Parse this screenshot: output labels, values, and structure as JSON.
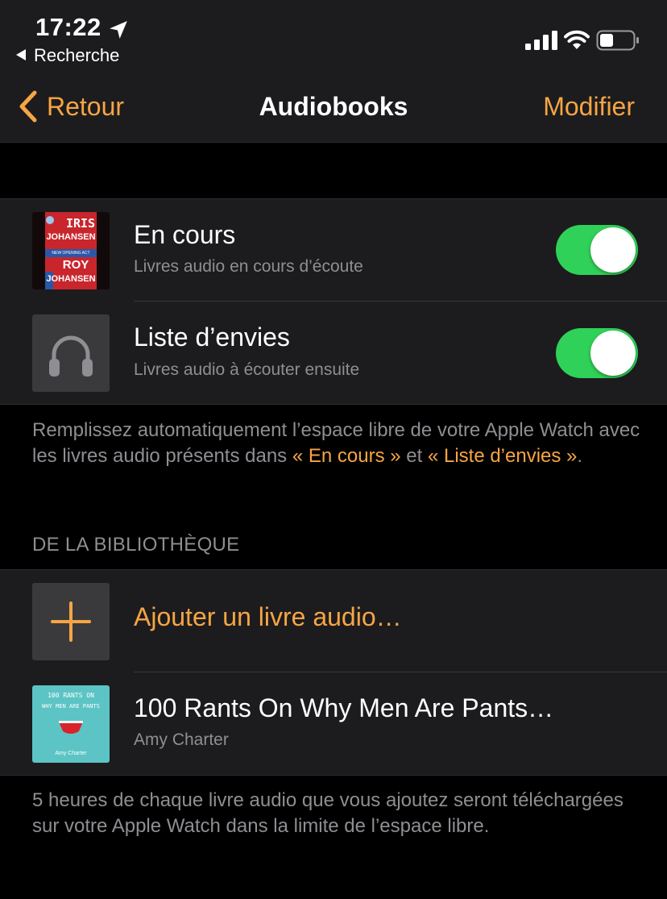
{
  "status_bar": {
    "time": "17:22",
    "back_app": "Recherche",
    "icons": [
      "location-arrow-icon",
      "signal-icon",
      "wifi-icon",
      "battery-icon"
    ]
  },
  "nav": {
    "back_label": "Retour",
    "title": "Audiobooks",
    "edit_label": "Modifier"
  },
  "auto_sync": {
    "items": [
      {
        "title": "En cours",
        "subtitle": "Livres audio en cours d’écoute",
        "enabled": true,
        "cover": {
          "line1": "IRIS",
          "line2": "JOHANSEN",
          "line3": "ROY",
          "line4": "JOHANSEN",
          "band": "NEW OPENING ACT"
        }
      },
      {
        "title": "Liste d’envies",
        "subtitle": "Livres audio à écouter ensuite",
        "enabled": true,
        "icon": "headphones-icon"
      }
    ],
    "footer_part1": "Remplissez automatiquement l’espace libre de votre Apple Watch avec les livres audio présents dans ",
    "footer_link1": "« En cours »",
    "footer_part2": " et ",
    "footer_link2": "« Liste d’envies »",
    "footer_part3": "."
  },
  "library": {
    "header": "DE LA BIBLIOTHÈQUE",
    "add_label": "Ajouter un livre audio…",
    "books": [
      {
        "title": "100 Rants On Why Men Are Pants…",
        "author": "Amy Charter",
        "cover": {
          "line1": "100 RANTS ON",
          "line2": "WHY MEN ARE PANTS",
          "author": "Amy Charter"
        }
      }
    ],
    "footer": "5 heures de chaque livre audio que vous ajoutez seront téléchargées sur votre Apple Watch dans la limite de l’espace libre."
  },
  "colors": {
    "accent": "#f7a543",
    "toggle_on": "#30d158",
    "background": "#000000",
    "cell": "#1c1c1e",
    "secondary_text": "#8e8e93"
  }
}
